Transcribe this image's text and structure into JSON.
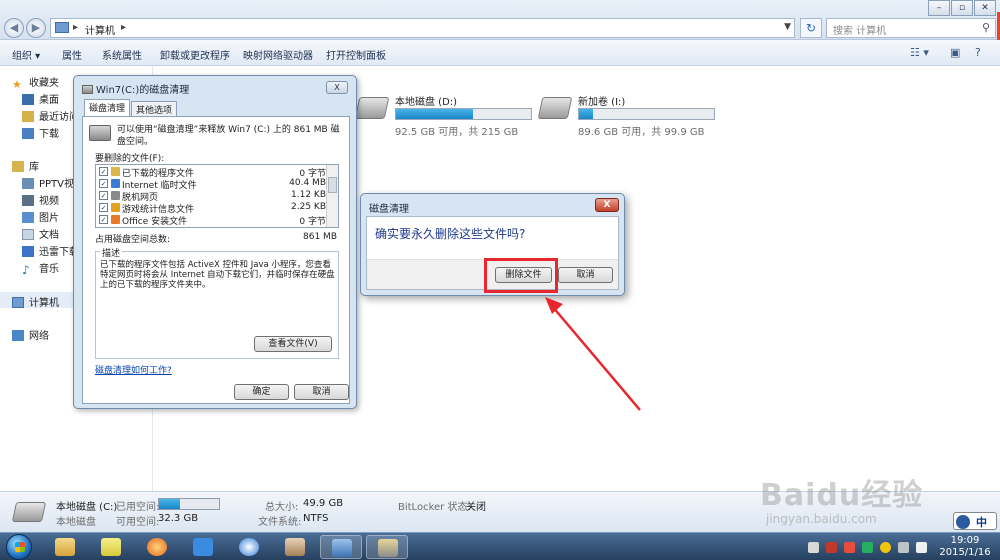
{
  "explorer": {
    "breadcrumb": [
      "计算机"
    ],
    "search_placeholder": "搜索 计算机",
    "toolbar": {
      "organize": "组织 ▾",
      "properties": "属性",
      "system_properties": "系统属性",
      "uninstall": "卸载或更改程序",
      "map_drive": "映射网络驱动器",
      "control_panel": "打开控制面板"
    },
    "sidebar": {
      "favorites": "收藏夹",
      "fav_items": [
        "桌面",
        "最近访问",
        "下载"
      ],
      "libraries": "库",
      "lib_items": [
        "PPTV视频",
        "视频",
        "图片",
        "文档",
        "迅雷下载",
        "音乐"
      ],
      "computer": "计算机",
      "network": "网络"
    },
    "drives": [
      {
        "name": "本地磁盘 (D:)",
        "free": "92.5 GB 可用，共 215 GB",
        "used_pct": 57
      },
      {
        "name": "新加卷 (I:)",
        "free": "89.6 GB 可用，共 99.9 GB",
        "used_pct": 10
      }
    ]
  },
  "details": {
    "name": "本地磁盘 (C:)",
    "type": "本地磁盘",
    "used_label": "已用空间:",
    "free_label": "可用空间:",
    "free_value": "32.3 GB",
    "used_pct": 35,
    "total_label": "总大小:",
    "total_value": "49.9 GB",
    "fs_label": "文件系统:",
    "fs_value": "NTFS",
    "bitlocker_label": "BitLocker 状态:",
    "bitlocker_value": "关闭"
  },
  "cleanup_dialog": {
    "title": "Win7(C:)的磁盘清理",
    "close": "X",
    "tabs": [
      "磁盘清理",
      "其他选项"
    ],
    "intro": "可以使用“磁盘清理”来释放 Win7 (C:) 上的 861 MB 磁盘空间。",
    "files_label": "要删除的文件(F):",
    "files": [
      {
        "name": "已下载的程序文件",
        "size": "0 字节",
        "color": "#d9b64a"
      },
      {
        "name": "Internet 临时文件",
        "size": "40.4 MB",
        "color": "#3a7bd5"
      },
      {
        "name": "脱机网页",
        "size": "1.12 KB",
        "color": "#8a8a8a"
      },
      {
        "name": "游戏统计信息文件",
        "size": "2.25 KB",
        "color": "#e6a020"
      },
      {
        "name": "Office 安装文件",
        "size": "0 字节",
        "color": "#e87a2a"
      }
    ],
    "total_label": "占用磁盘空间总数:",
    "total_value": "861 MB",
    "desc_legend": "描述",
    "desc_text": "已下载的程序文件包括 ActiveX 控件和 Java 小程序，您查看特定网页时将会从 Internet 自动下载它们，并临时保存在硬盘上的已下载的程序文件夹中。",
    "view_files": "查看文件(V)",
    "help_link": "磁盘清理如何工作?",
    "ok": "确定",
    "cancel": "取消"
  },
  "confirm_dialog": {
    "title": "磁盘清理",
    "close": "X",
    "message": "确实要永久删除这些文件吗?",
    "delete": "删除文件",
    "cancel": "取消"
  },
  "taskbar": {
    "time": "19:09",
    "date": "2015/1/16",
    "ime": "中"
  },
  "watermark": {
    "brand": "Baidu经验",
    "url": "jingyan.baidu.com"
  },
  "colors": {
    "highlight": "#e8262d",
    "accent": "#1b86c8"
  }
}
